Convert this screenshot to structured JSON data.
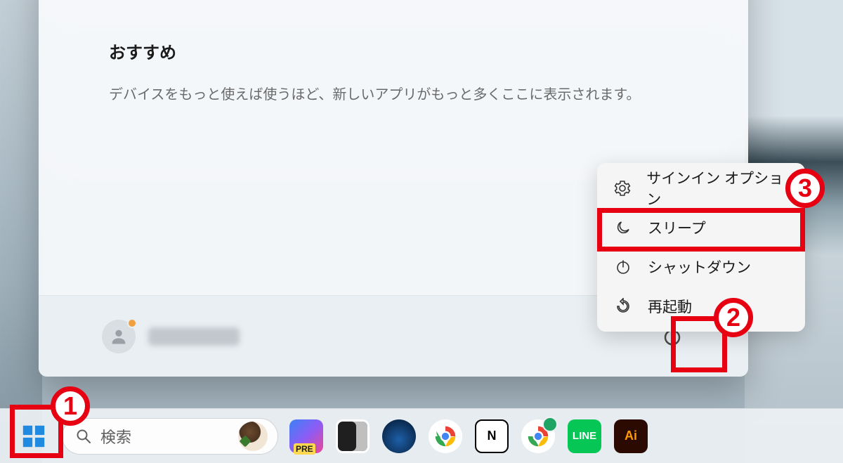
{
  "start_panel": {
    "recommended_title": "おすすめ",
    "recommended_body": "デバイスをもっと使えば使うほど、新しいアプリがもっと多くここに表示されます。"
  },
  "power_menu": {
    "signin_options": "サインイン オプション",
    "sleep": "スリープ",
    "shutdown": "シャットダウン",
    "restart": "再起動"
  },
  "taskbar": {
    "search_placeholder": "検索",
    "notion_glyph": "N",
    "line_glyph": "LINE",
    "ai_glyph": "Ai"
  },
  "annotations": {
    "one": "1",
    "two": "2",
    "three": "3"
  }
}
